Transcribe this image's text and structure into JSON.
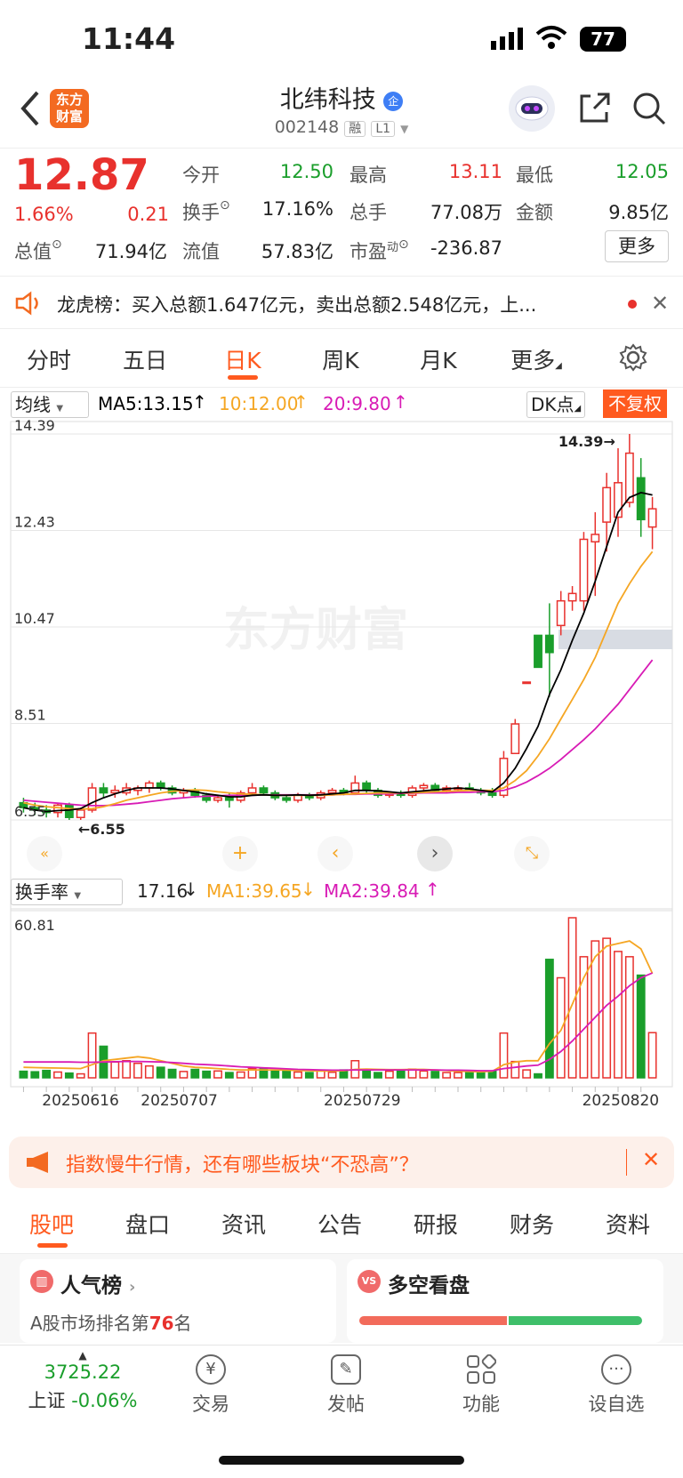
{
  "status": {
    "time": "11:44",
    "battery": "77"
  },
  "header": {
    "logo_text": "东方财富",
    "stock_name": "北纬科技",
    "enterprise_badge": "企",
    "stock_code": "002148",
    "badge_rong": "融",
    "badge_level": "L1"
  },
  "quote": {
    "price": "12.87",
    "change_pct": "1.66%",
    "change_amt": "0.21",
    "open_label": "今开",
    "open": "12.50",
    "high_label": "最高",
    "high": "13.11",
    "low_label": "最低",
    "low": "12.05",
    "turnover_label": "换手",
    "turnover": "17.16%",
    "volume_label": "总手",
    "volume": "77.08万",
    "amount_label": "金额",
    "amount": "9.85亿",
    "mktcap_label": "总值",
    "mktcap": "71.94亿",
    "float_label": "流值",
    "float": "57.83亿",
    "pe_label": "市盈",
    "pe_sup": "动",
    "pe": "-236.87",
    "more_button": "更多"
  },
  "notice": {
    "text": "龙虎榜：买入总额1.647亿元，卖出总额2.548亿元，上..."
  },
  "chart_tabs": [
    {
      "label": "分时"
    },
    {
      "label": "五日"
    },
    {
      "label": "日K"
    },
    {
      "label": "周K"
    },
    {
      "label": "月K"
    },
    {
      "label": "更多"
    }
  ],
  "chart_toolbar": {
    "ma_select": "均线",
    "ma5": "MA5:13.15",
    "ma10": "10:12.00",
    "ma20": "20:9.80",
    "dk_button": "DK点",
    "adjust_button": "不复权"
  },
  "price_axis": {
    "labels": [
      "14.39",
      "12.43",
      "10.47",
      "8.51",
      "6.55"
    ]
  },
  "annotations": {
    "max": "14.39",
    "min": "6.55"
  },
  "watermark": "东方财富",
  "indicator_toolbar": {
    "select": "换手率",
    "value": "17.16",
    "ma1": "MA1:39.65",
    "ma2": "MA2:39.84"
  },
  "volume_axis": {
    "max": "60.81"
  },
  "date_axis": {
    "labels": [
      "20250616",
      "20250707",
      "20250729",
      "20250820"
    ]
  },
  "colors": {
    "up": "#e8312d",
    "down": "#1a9e2b",
    "ma5": "#000000",
    "ma10": "#f5a623",
    "ma20": "#d81bb5",
    "accent": "#ff5a1f"
  },
  "chart_data": {
    "type": "candlestick",
    "ylim": [
      6.55,
      14.39
    ],
    "candles": [
      {
        "o": 6.9,
        "h": 7.0,
        "l": 6.7,
        "c": 6.8
      },
      {
        "o": 6.8,
        "h": 6.9,
        "l": 6.65,
        "c": 6.75
      },
      {
        "o": 6.75,
        "h": 6.85,
        "l": 6.6,
        "c": 6.7
      },
      {
        "o": 6.7,
        "h": 6.9,
        "l": 6.6,
        "c": 6.85
      },
      {
        "o": 6.85,
        "h": 6.9,
        "l": 6.55,
        "c": 6.6
      },
      {
        "o": 6.6,
        "h": 6.8,
        "l": 6.55,
        "c": 6.75
      },
      {
        "o": 6.75,
        "h": 7.3,
        "l": 6.7,
        "c": 7.2
      },
      {
        "o": 7.2,
        "h": 7.3,
        "l": 7.0,
        "c": 7.1
      },
      {
        "o": 7.1,
        "h": 7.25,
        "l": 7.0,
        "c": 7.15
      },
      {
        "o": 7.1,
        "h": 7.3,
        "l": 7.05,
        "c": 7.2
      },
      {
        "o": 7.15,
        "h": 7.25,
        "l": 7.05,
        "c": 7.2
      },
      {
        "o": 7.2,
        "h": 7.35,
        "l": 7.1,
        "c": 7.3
      },
      {
        "o": 7.3,
        "h": 7.35,
        "l": 7.15,
        "c": 7.2
      },
      {
        "o": 7.2,
        "h": 7.25,
        "l": 7.05,
        "c": 7.1
      },
      {
        "o": 7.1,
        "h": 7.2,
        "l": 7.0,
        "c": 7.15
      },
      {
        "o": 7.15,
        "h": 7.2,
        "l": 7.0,
        "c": 7.05
      },
      {
        "o": 7.05,
        "h": 7.1,
        "l": 6.9,
        "c": 6.95
      },
      {
        "o": 6.95,
        "h": 7.05,
        "l": 6.9,
        "c": 7.0
      },
      {
        "o": 7.0,
        "h": 7.1,
        "l": 6.8,
        "c": 6.95
      },
      {
        "o": 6.95,
        "h": 7.15,
        "l": 6.9,
        "c": 7.1
      },
      {
        "o": 7.1,
        "h": 7.3,
        "l": 7.05,
        "c": 7.2
      },
      {
        "o": 7.2,
        "h": 7.25,
        "l": 7.05,
        "c": 7.1
      },
      {
        "o": 7.1,
        "h": 7.15,
        "l": 6.95,
        "c": 7.0
      },
      {
        "o": 7.0,
        "h": 7.05,
        "l": 6.9,
        "c": 6.95
      },
      {
        "o": 6.95,
        "h": 7.1,
        "l": 6.9,
        "c": 7.05
      },
      {
        "o": 7.05,
        "h": 7.1,
        "l": 6.95,
        "c": 7.0
      },
      {
        "o": 7.0,
        "h": 7.15,
        "l": 6.95,
        "c": 7.1
      },
      {
        "o": 7.1,
        "h": 7.2,
        "l": 7.05,
        "c": 7.15
      },
      {
        "o": 7.15,
        "h": 7.2,
        "l": 7.05,
        "c": 7.1
      },
      {
        "o": 7.1,
        "h": 7.45,
        "l": 7.1,
        "c": 7.3
      },
      {
        "o": 7.3,
        "h": 7.35,
        "l": 7.1,
        "c": 7.15
      },
      {
        "o": 7.15,
        "h": 7.2,
        "l": 7.0,
        "c": 7.05
      },
      {
        "o": 7.05,
        "h": 7.1,
        "l": 7.0,
        "c": 7.1
      },
      {
        "o": 7.1,
        "h": 7.15,
        "l": 7.0,
        "c": 7.05
      },
      {
        "o": 7.05,
        "h": 7.25,
        "l": 7.0,
        "c": 7.2
      },
      {
        "o": 7.2,
        "h": 7.3,
        "l": 7.1,
        "c": 7.25
      },
      {
        "o": 7.25,
        "h": 7.3,
        "l": 7.1,
        "c": 7.15
      },
      {
        "o": 7.15,
        "h": 7.25,
        "l": 7.1,
        "c": 7.2
      },
      {
        "o": 7.2,
        "h": 7.25,
        "l": 7.15,
        "c": 7.2
      },
      {
        "o": 7.2,
        "h": 7.3,
        "l": 7.15,
        "c": 7.15
      },
      {
        "o": 7.15,
        "h": 7.2,
        "l": 7.05,
        "c": 7.1
      },
      {
        "o": 7.1,
        "h": 7.2,
        "l": 7.0,
        "c": 7.05
      },
      {
        "o": 7.05,
        "h": 7.95,
        "l": 7.0,
        "c": 7.8
      },
      {
        "o": 7.9,
        "h": 8.6,
        "l": 7.9,
        "c": 8.5
      },
      {
        "o": 9.35,
        "h": 9.35,
        "l": 9.35,
        "c": 9.35
      },
      {
        "o": 10.3,
        "h": 10.3,
        "l": 9.7,
        "c": 9.65
      },
      {
        "o": 10.3,
        "h": 10.95,
        "l": 9.05,
        "c": 9.95
      },
      {
        "o": 10.5,
        "h": 11.2,
        "l": 10.3,
        "c": 11.0
      },
      {
        "o": 11.0,
        "h": 11.3,
        "l": 10.8,
        "c": 11.15
      },
      {
        "o": 11.0,
        "h": 12.4,
        "l": 10.8,
        "c": 12.25
      },
      {
        "o": 12.2,
        "h": 12.8,
        "l": 11.1,
        "c": 12.35
      },
      {
        "o": 12.6,
        "h": 13.6,
        "l": 12.0,
        "c": 13.3
      },
      {
        "o": 12.7,
        "h": 14.1,
        "l": 12.3,
        "c": 13.4
      },
      {
        "o": 13.0,
        "h": 14.39,
        "l": 12.9,
        "c": 14.0
      },
      {
        "o": 13.5,
        "h": 13.9,
        "l": 12.3,
        "c": 12.65
      },
      {
        "o": 12.5,
        "h": 13.11,
        "l": 12.05,
        "c": 12.87
      }
    ],
    "ma5": [
      6.8,
      6.75,
      6.72,
      6.74,
      6.75,
      6.78,
      6.9,
      7.0,
      7.08,
      7.15,
      7.2,
      7.2,
      7.2,
      7.18,
      7.15,
      7.12,
      7.08,
      7.05,
      7.02,
      7.02,
      7.05,
      7.06,
      7.05,
      7.05,
      7.06,
      7.05,
      7.06,
      7.08,
      7.1,
      7.15,
      7.15,
      7.14,
      7.12,
      7.1,
      7.12,
      7.14,
      7.16,
      7.18,
      7.2,
      7.18,
      7.15,
      7.12,
      7.3,
      7.6,
      8.0,
      8.45,
      9.1,
      9.6,
      10.2,
      10.75,
      11.4,
      12.1,
      12.8,
      13.1,
      13.2,
      13.15
    ],
    "ma10": [
      6.9,
      6.85,
      6.82,
      6.8,
      6.78,
      6.77,
      6.78,
      6.82,
      6.88,
      6.95,
      7.0,
      7.05,
      7.1,
      7.13,
      7.15,
      7.16,
      7.15,
      7.12,
      7.1,
      7.08,
      7.07,
      7.06,
      7.05,
      7.05,
      7.05,
      7.05,
      7.05,
      7.06,
      7.07,
      7.08,
      7.09,
      7.1,
      7.1,
      7.1,
      7.1,
      7.11,
      7.12,
      7.13,
      7.14,
      7.15,
      7.15,
      7.15,
      7.2,
      7.35,
      7.55,
      7.85,
      8.2,
      8.6,
      9.0,
      9.4,
      9.85,
      10.4,
      10.95,
      11.35,
      11.7,
      12.0
    ],
    "ma20": [
      6.95,
      6.93,
      6.91,
      6.89,
      6.87,
      6.85,
      6.84,
      6.84,
      6.85,
      6.87,
      6.89,
      6.92,
      6.95,
      6.98,
      7.0,
      7.02,
      7.03,
      7.04,
      7.05,
      7.05,
      7.05,
      7.06,
      7.06,
      7.06,
      7.06,
      7.06,
      7.06,
      7.06,
      7.07,
      7.07,
      7.08,
      7.08,
      7.08,
      7.09,
      7.09,
      7.1,
      7.1,
      7.1,
      7.11,
      7.11,
      7.12,
      7.12,
      7.15,
      7.22,
      7.32,
      7.45,
      7.6,
      7.78,
      7.98,
      8.18,
      8.4,
      8.65,
      8.9,
      9.2,
      9.5,
      9.8
    ],
    "turnover": [
      2.5,
      2.3,
      2.8,
      2.2,
      1.8,
      1.5,
      17.0,
      12.0,
      6.0,
      6.5,
      5.5,
      4.5,
      4.0,
      3.2,
      2.4,
      3.2,
      2.5,
      2.6,
      2.0,
      2.2,
      3.5,
      3.3,
      3.0,
      2.5,
      2.2,
      2.0,
      2.6,
      2.1,
      3.0,
      6.5,
      3.0,
      2.0,
      2.5,
      2.8,
      3.3,
      2.6,
      2.4,
      2.0,
      2.0,
      2.1,
      1.9,
      2.6,
      17.0,
      6.2,
      3.0,
      1.5,
      45.0,
      38.0,
      60.81,
      46.0,
      52.0,
      53.0,
      48.0,
      46.0,
      39.0,
      17.16
    ],
    "ma1": [
      4.0,
      3.9,
      3.8,
      3.7,
      3.6,
      3.5,
      5.0,
      6.5,
      7.0,
      7.5,
      8.0,
      7.5,
      6.5,
      5.5,
      4.5,
      4.0,
      3.8,
      3.5,
      3.2,
      3.0,
      3.0,
      3.0,
      3.0,
      2.9,
      2.8,
      2.7,
      2.6,
      2.6,
      2.7,
      3.2,
      3.3,
      3.2,
      3.1,
      3.1,
      3.2,
      3.2,
      3.0,
      2.8,
      2.5,
      2.4,
      2.3,
      2.5,
      5.0,
      6.0,
      6.5,
      6.5,
      13.0,
      18.0,
      28.0,
      38.0,
      46.0,
      50.0,
      51.0,
      52.0,
      49.0,
      39.65
    ],
    "ma2": [
      6.0,
      6.0,
      6.0,
      6.0,
      6.0,
      5.9,
      5.9,
      6.0,
      6.1,
      6.2,
      6.2,
      6.1,
      6.0,
      5.8,
      5.5,
      5.2,
      5.0,
      4.8,
      4.5,
      4.2,
      4.0,
      3.8,
      3.6,
      3.4,
      3.2,
      3.1,
      3.0,
      2.9,
      2.9,
      3.0,
      3.0,
      3.0,
      3.0,
      3.0,
      3.0,
      3.0,
      3.0,
      2.9,
      2.9,
      2.8,
      2.7,
      2.7,
      3.5,
      4.0,
      4.5,
      4.8,
      7.0,
      10.0,
      14.0,
      18.5,
      23.0,
      27.5,
      31.0,
      35.0,
      38.0,
      39.84
    ]
  },
  "banner": {
    "text": "指数慢牛行情，还有哪些板块“不恐高”？"
  },
  "sub_tabs": [
    {
      "label": "股吧"
    },
    {
      "label": "盘口"
    },
    {
      "label": "资讯"
    },
    {
      "label": "公告"
    },
    {
      "label": "研报"
    },
    {
      "label": "财务"
    },
    {
      "label": "资料"
    }
  ],
  "cards": {
    "popularity_title": "人气榜",
    "popularity_text_prefix": "A股市场排名第",
    "popularity_rank": "76",
    "popularity_text_suffix": "名",
    "bullbear_title": "多空看盘"
  },
  "bottom_nav": {
    "index_value": "3725.22",
    "index_name": "上证",
    "index_change": "-0.06%",
    "trade": "交易",
    "post": "发帖",
    "functions": "功能",
    "watchlist": "设自选"
  }
}
